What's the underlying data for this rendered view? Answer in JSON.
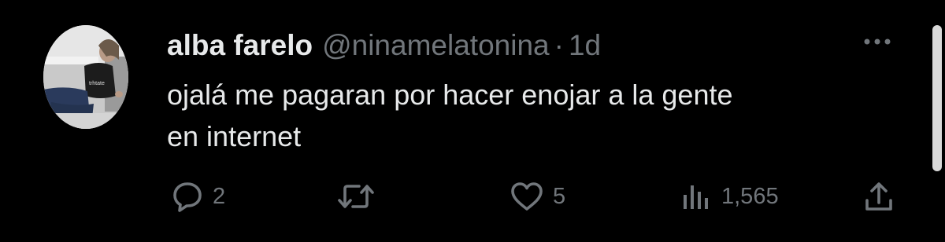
{
  "tweet": {
    "author": {
      "display_name": "alba farelo",
      "handle": "@ninamelatonina"
    },
    "separator": "·",
    "timestamp": "1d",
    "text_lines": [
      "ojalá me pagaran por hacer enojar a la gente",
      "en internet"
    ],
    "actions": {
      "reply": {
        "icon": "reply-icon",
        "count": "2"
      },
      "retweet": {
        "icon": "retweet-icon",
        "count": ""
      },
      "like": {
        "icon": "heart-icon",
        "count": "5"
      },
      "views": {
        "icon": "views-icon",
        "count": "1,565"
      },
      "share": {
        "icon": "share-icon",
        "count": ""
      }
    }
  },
  "colors": {
    "background": "#000000",
    "primary_text": "#e7e9ea",
    "secondary_text": "#71767b",
    "scrollbar": "#d9d9d9"
  }
}
